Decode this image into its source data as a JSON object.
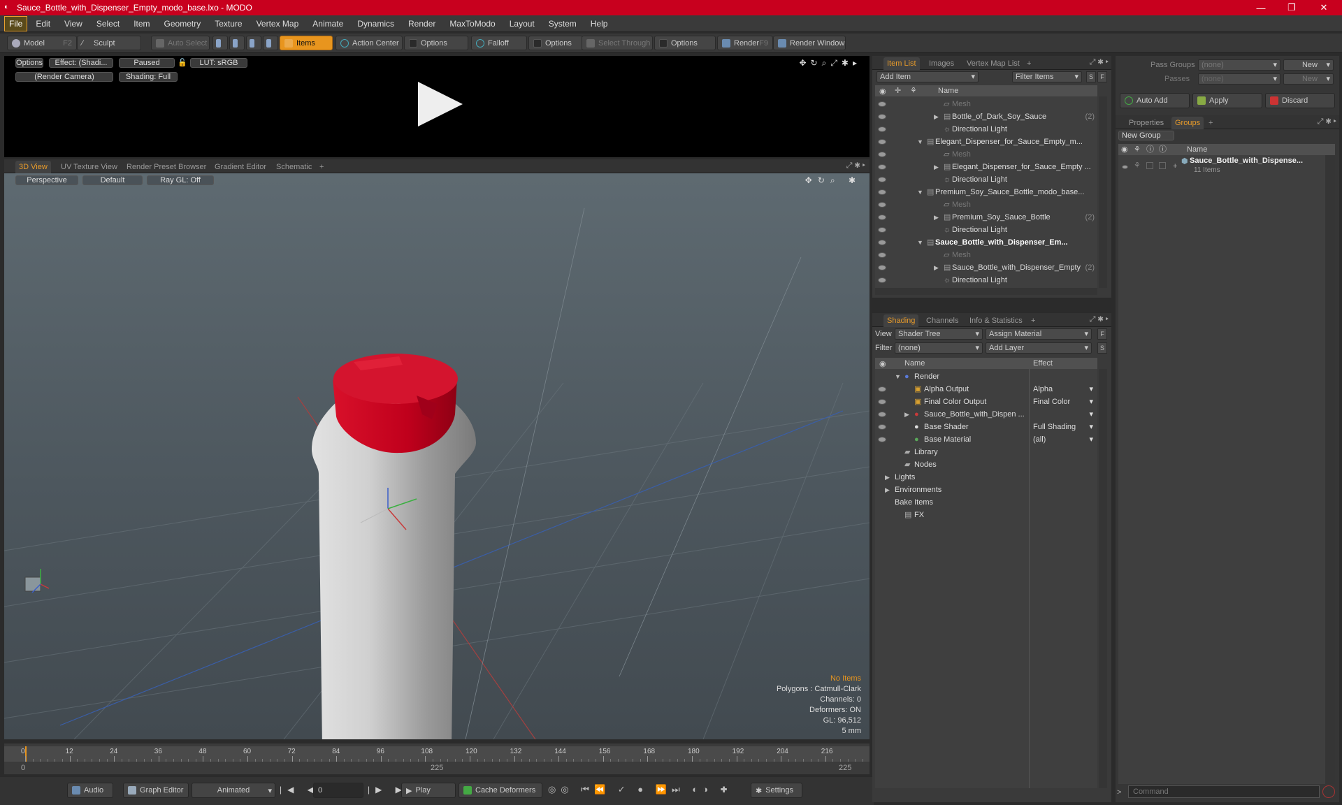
{
  "window": {
    "title": "Sauce_Bottle_with_Dispenser_Empty_modo_base.lxo - MODO",
    "min": "—",
    "max": "❐",
    "close": "✕"
  },
  "menu": [
    "File",
    "Edit",
    "View",
    "Select",
    "Item",
    "Geometry",
    "Texture",
    "Vertex Map",
    "Animate",
    "Dynamics",
    "Render",
    "MaxToModo",
    "Layout",
    "System",
    "Help"
  ],
  "toolbar": {
    "model": "Model",
    "model_key": "F2",
    "sculpt": "Sculpt",
    "auto_select": "Auto Select",
    "items": "Items",
    "action_center": "Action Center",
    "options1": "Options",
    "falloff": "Falloff",
    "options2": "Options",
    "select_through": "Select Through",
    "options3": "Options",
    "render": "Render",
    "render_key": "F9",
    "render_window": "Render Window"
  },
  "preview": {
    "options": "Options",
    "effect": "Effect: (Shadi...",
    "paused": "Paused",
    "lut": "LUT: sRGB",
    "camera": "(Render Camera)",
    "shading": "Shading: Full"
  },
  "view_tabs": [
    "3D View",
    "UV Texture View",
    "Render Preset Browser",
    "Gradient Editor",
    "Schematic",
    "+"
  ],
  "viewport": {
    "perspective": "Perspective",
    "default": "Default",
    "raygl": "Ray GL: Off",
    "info": [
      "No Items",
      "Polygons : Catmull-Clark",
      "Channels: 0",
      "Deformers: ON",
      "GL: 96,512",
      "5 mm"
    ]
  },
  "timeline": {
    "ticks": [
      "0",
      "12",
      "24",
      "36",
      "48",
      "60",
      "72",
      "84",
      "96",
      "108",
      "120",
      "132",
      "144",
      "156",
      "168",
      "180",
      "192",
      "204",
      "216"
    ],
    "start": "0",
    "mid": "225",
    "end": "225"
  },
  "bottom": {
    "audio": "Audio",
    "graph_editor": "Graph Editor",
    "animated": "Animated",
    "frame": "0",
    "play": "Play",
    "cache": "Cache Deformers",
    "settings": "Settings"
  },
  "item_list": {
    "tabs": [
      "Item List",
      "Images",
      "Vertex Map List",
      "+"
    ],
    "add_item": "Add Item",
    "filter": "Filter Items",
    "s": "S",
    "f": "F",
    "col_name": "Name",
    "rows": [
      {
        "label": "Mesh",
        "dim": true,
        "indent": 3
      },
      {
        "label": "Bottle_of_Dark_Soy_Sauce",
        "count": "(2)",
        "indent": 3,
        "arrow": "▶"
      },
      {
        "label": "Directional Light",
        "indent": 3
      },
      {
        "label": "Elegant_Dispenser_for_Sauce_Empty_m...",
        "indent": 1,
        "arrow": "▼"
      },
      {
        "label": "Mesh",
        "dim": true,
        "indent": 3
      },
      {
        "label": "Elegant_Dispenser_for_Sauce_Empty ...",
        "indent": 3,
        "arrow": "▶"
      },
      {
        "label": "Directional Light",
        "indent": 3
      },
      {
        "label": "Premium_Soy_Sauce_Bottle_modo_base...",
        "indent": 1,
        "arrow": "▼"
      },
      {
        "label": "Mesh",
        "dim": true,
        "indent": 3
      },
      {
        "label": "Premium_Soy_Sauce_Bottle",
        "count": "(2)",
        "indent": 3,
        "arrow": "▶"
      },
      {
        "label": "Directional Light",
        "indent": 3
      },
      {
        "label": "Sauce_Bottle_with_Dispenser_Em...",
        "bold": true,
        "indent": 1,
        "arrow": "▼"
      },
      {
        "label": "Mesh",
        "dim": true,
        "indent": 3
      },
      {
        "label": "Sauce_Bottle_with_Dispenser_Empty",
        "count": "(2)",
        "indent": 3,
        "arrow": "▶"
      },
      {
        "label": "Directional Light",
        "indent": 3
      }
    ]
  },
  "shading": {
    "tabs": [
      "Shading",
      "Channels",
      "Info & Statistics",
      "+"
    ],
    "view_label": "View",
    "view_value": "Shader Tree",
    "assign": "Assign Material",
    "f": "F",
    "filter_label": "Filter",
    "filter_value": "(none)",
    "add_layer": "Add Layer",
    "s": "S",
    "col_name": "Name",
    "col_effect": "Effect",
    "rows": [
      {
        "label": "Render",
        "effect": "",
        "indent": 0,
        "arrow": "▼",
        "eye": false
      },
      {
        "label": "Alpha Output",
        "effect": "Alpha",
        "indent": 1,
        "eye": true
      },
      {
        "label": "Final Color Output",
        "effect": "Final Color",
        "indent": 1,
        "eye": true
      },
      {
        "label": "Sauce_Bottle_with_Dispen ...",
        "effect": "",
        "indent": 1,
        "arrow": "▶",
        "eye": true
      },
      {
        "label": "Base Shader",
        "effect": "Full Shading",
        "indent": 1,
        "eye": true
      },
      {
        "label": "Base Material",
        "effect": "(all)",
        "indent": 1,
        "eye": true
      },
      {
        "label": "Library",
        "effect": "",
        "indent": 0,
        "eye": false
      },
      {
        "label": "Nodes",
        "effect": "",
        "indent": 0,
        "eye": false
      },
      {
        "label": "Lights",
        "effect": "",
        "indent": -1,
        "arrow": "▶",
        "eye": false
      },
      {
        "label": "Environments",
        "effect": "",
        "indent": -1,
        "arrow": "▶",
        "eye": false
      },
      {
        "label": "Bake Items",
        "effect": "",
        "indent": -1,
        "eye": false
      },
      {
        "label": "FX",
        "effect": "",
        "indent": 0,
        "eye": false
      }
    ]
  },
  "groups": {
    "pass_groups": "Pass Groups",
    "pass_value": "(none)",
    "new": "New",
    "passes": "Passes",
    "passes_value": "(none)",
    "new2": "New",
    "auto_add": "Auto Add",
    "apply": "Apply",
    "discard": "Discard",
    "tabs": [
      "Properties",
      "Groups",
      "+"
    ],
    "new_group": "New Group",
    "col_name": "Name",
    "item": "Sauce_Bottle_with_Dispense...",
    "item_sub": "11 Items"
  },
  "command": {
    "placeholder": "Command"
  },
  "colors": {
    "accent": "#e8951e",
    "title": "#c8001e",
    "cap": "#c8001e"
  }
}
